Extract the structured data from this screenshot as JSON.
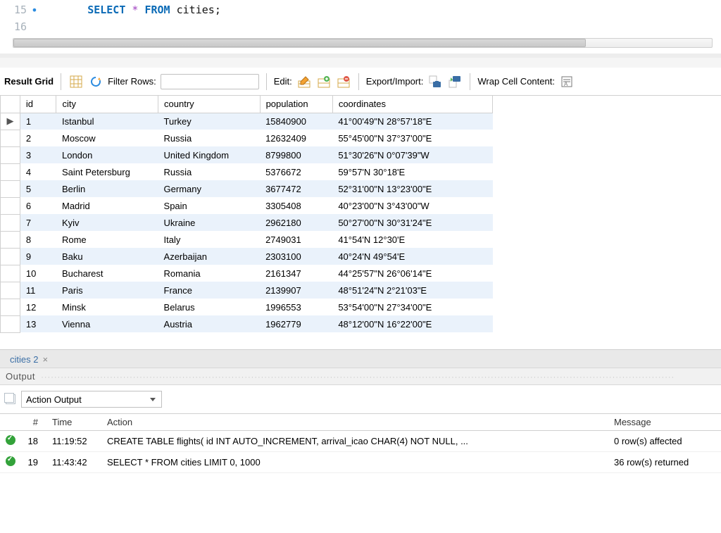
{
  "editor": {
    "lines": [
      {
        "num": "15",
        "has_bp": true
      },
      {
        "num": "16",
        "has_bp": false
      }
    ],
    "sql": {
      "select": "SELECT",
      "star": "*",
      "from": "FROM",
      "ident": "cities",
      "semi": ";"
    }
  },
  "toolbar": {
    "result_grid": "Result Grid",
    "filter_rows": "Filter Rows:",
    "filter_placeholder": "",
    "edit": "Edit:",
    "export_import": "Export/Import:",
    "wrap": "Wrap Cell Content:"
  },
  "grid": {
    "columns": [
      "id",
      "city",
      "country",
      "population",
      "coordinates"
    ],
    "rows": [
      {
        "id": "1",
        "city": "Istanbul",
        "country": "Turkey",
        "population": "15840900",
        "coordinates": "41°00'49\"N 28°57'18\"E"
      },
      {
        "id": "2",
        "city": "Moscow",
        "country": "Russia",
        "population": "12632409",
        "coordinates": "55°45'00\"N 37°37'00\"E"
      },
      {
        "id": "3",
        "city": "London",
        "country": "United Kingdom",
        "population": "8799800",
        "coordinates": "51°30'26\"N 0°07'39\"W"
      },
      {
        "id": "4",
        "city": "Saint Petersburg",
        "country": "Russia",
        "population": "5376672",
        "coordinates": "59°57'N 30°18'E"
      },
      {
        "id": "5",
        "city": "Berlin",
        "country": "Germany",
        "population": "3677472",
        "coordinates": "52°31'00\"N 13°23'00\"E"
      },
      {
        "id": "6",
        "city": "Madrid",
        "country": "Spain",
        "population": "3305408",
        "coordinates": "40°23'00\"N 3°43'00\"W"
      },
      {
        "id": "7",
        "city": "Kyiv",
        "country": "Ukraine",
        "population": "2962180",
        "coordinates": "50°27'00\"N 30°31'24\"E"
      },
      {
        "id": "8",
        "city": "Rome",
        "country": "Italy",
        "population": "2749031",
        "coordinates": "41°54'N 12°30'E"
      },
      {
        "id": "9",
        "city": "Baku",
        "country": "Azerbaijan",
        "population": "2303100",
        "coordinates": "40°24'N 49°54'E"
      },
      {
        "id": "10",
        "city": "Bucharest",
        "country": "Romania",
        "population": "2161347",
        "coordinates": "44°25'57\"N 26°06'14\"E"
      },
      {
        "id": "11",
        "city": "Paris",
        "country": "France",
        "population": "2139907",
        "coordinates": "48°51'24\"N 2°21'03\"E"
      },
      {
        "id": "12",
        "city": "Minsk",
        "country": "Belarus",
        "population": "1996553",
        "coordinates": "53°54'00\"N 27°34'00\"E"
      },
      {
        "id": "13",
        "city": "Vienna",
        "country": "Austria",
        "population": "1962779",
        "coordinates": "48°12'00\"N 16°22'00\"E"
      }
    ]
  },
  "tabs": {
    "result_tab": "cities 2",
    "close": "×"
  },
  "output": {
    "title": "Output",
    "mode": "Action Output",
    "columns": {
      "num": "#",
      "time": "Time",
      "action": "Action",
      "message": "Message"
    },
    "rows": [
      {
        "status": "ok",
        "num": "18",
        "time": "11:19:52",
        "action": "CREATE TABLE flights( id INT AUTO_INCREMENT, arrival_icao CHAR(4) NOT NULL, ...",
        "message": "0 row(s) affected"
      },
      {
        "status": "ok",
        "num": "19",
        "time": "11:43:42",
        "action": "SELECT * FROM cities LIMIT 0, 1000",
        "message": "36 row(s) returned"
      }
    ]
  }
}
